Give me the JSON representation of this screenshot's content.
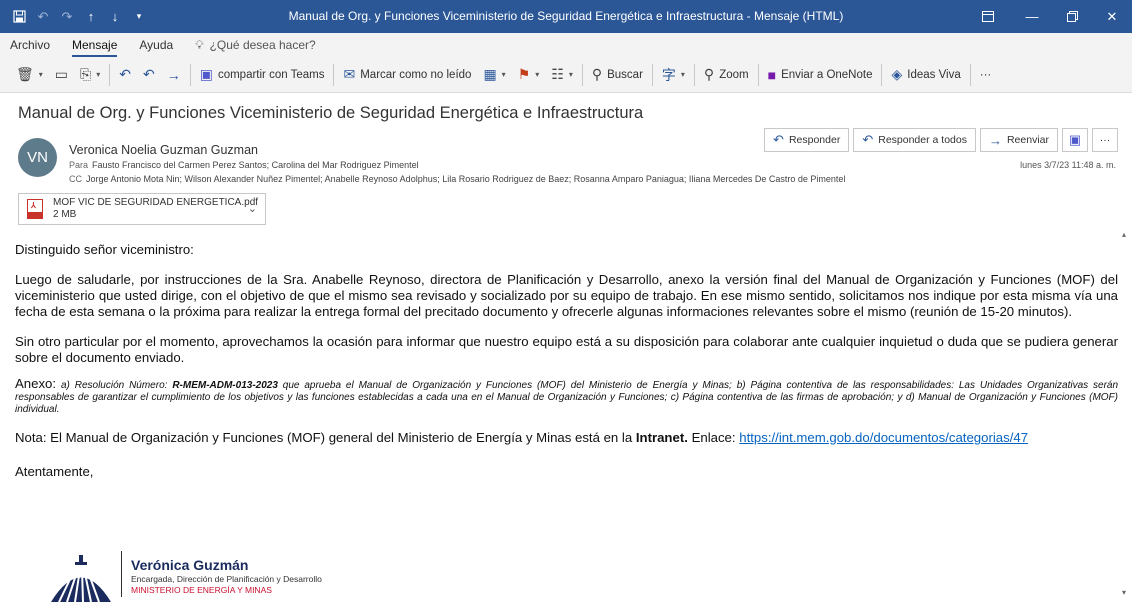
{
  "window": {
    "title": "Manual de Org. y Funciones Viceministerio de Seguridad Energética e Infraestructura  -  Mensaje (HTML)"
  },
  "ribbon_tabs": [
    "Archivo",
    "Mensaje",
    "Ayuda"
  ],
  "tell_me": "¿Qué desea hacer?",
  "toolbar": {
    "teams": "compartir con Teams",
    "mark_unread": "Marcar como no leído",
    "search": "Buscar",
    "zoom": "Zoom",
    "onenote": "Enviar a OneNote",
    "ideas": "Ideas Viva",
    "more": "···"
  },
  "message": {
    "subject": "Manual de Org. y Funciones Viceministerio de Seguridad Energética e Infraestructura",
    "avatar_initials": "VN",
    "sender": "Veronica Noelia Guzman Guzman",
    "to_label": "Para",
    "to": "Fausto Francisco del Carmen Perez Santos; Carolina del Mar Rodriguez Pimentel",
    "cc_label": "CC",
    "cc": "Jorge Antonio Mota Nin; Wilson Alexander Nuñez Pimentel; Anabelle Reynoso Adolphus; Lila Rosario Rodriguez de Baez; Rosanna Amparo Paniagua; Iliana Mercedes De Castro de Pimentel",
    "datetime": "lunes 3/7/23 11:48 a. m.",
    "actions": {
      "reply": "Responder",
      "reply_all": "Responder a todos",
      "forward": "Reenviar",
      "more": "···"
    },
    "attachment": {
      "name": "MOF VIC DE SEGURIDAD ENERGETICA.pdf",
      "size": "2 MB"
    }
  },
  "body": {
    "greeting": "Distinguido señor viceministro:",
    "para1": "Luego de saludarle, por instrucciones de la Sra. Anabelle Reynoso, directora de Planificación y Desarrollo, anexo la versión final del Manual de Organización y Funciones (MOF) del viceministerio que usted dirige, con el objetivo de que el mismo sea revisado y socializado por su equipo de trabajo. En ese mismo sentido, solicitamos nos indique por esta misma vía una fecha de esta semana o la próxima para realizar la entrega formal del precitado documento y ofrecerle algunas informaciones relevantes sobre el mismo (reunión de 15-20 minutos).",
    "para2": "Sin otro particular por el momento, aprovechamos la ocasión para informar que nuestro equipo está a su disposición para colaborar ante cualquier inquietud o duda que se pudiera generar sobre el documento enviado.",
    "annex_lead": "Anexo:",
    "annex_a": "a) Resolución Número:",
    "annex_code": "R-MEM-ADM-013-2023",
    "annex_rest": "que aprueba el Manual de Organización y Funciones (MOF) del Ministerio de Energía y Minas; b) Página contentiva de las responsabilidades: Las Unidades Organizativas serán responsables de garantizar el cumplimiento de los objetivos y las funciones establecidas a cada una en el Manual de Organización y Funciones; c) Página contentiva de las firmas de aprobación; y d) Manual de Organización y Funciones (MOF) individual.",
    "note_start": "Nota: El Manual de Organización y Funciones (MOF) general del Ministerio de Energía y Minas está en la",
    "note_bold": "Intranet.",
    "note_link_label": "Enlace:",
    "note_link": "https://int.mem.gob.do/documentos/categorias/47",
    "closing": "Atentamente,"
  },
  "signature": {
    "name": "Verónica Guzmán",
    "role": "Encargada, Dirección de Planificación y Desarrollo",
    "org": "MINISTERIO DE ENERGÍA Y MINAS"
  },
  "colors": {
    "titlebar": "#2b5797",
    "link": "#0563c1",
    "org_red": "#c8102e"
  }
}
